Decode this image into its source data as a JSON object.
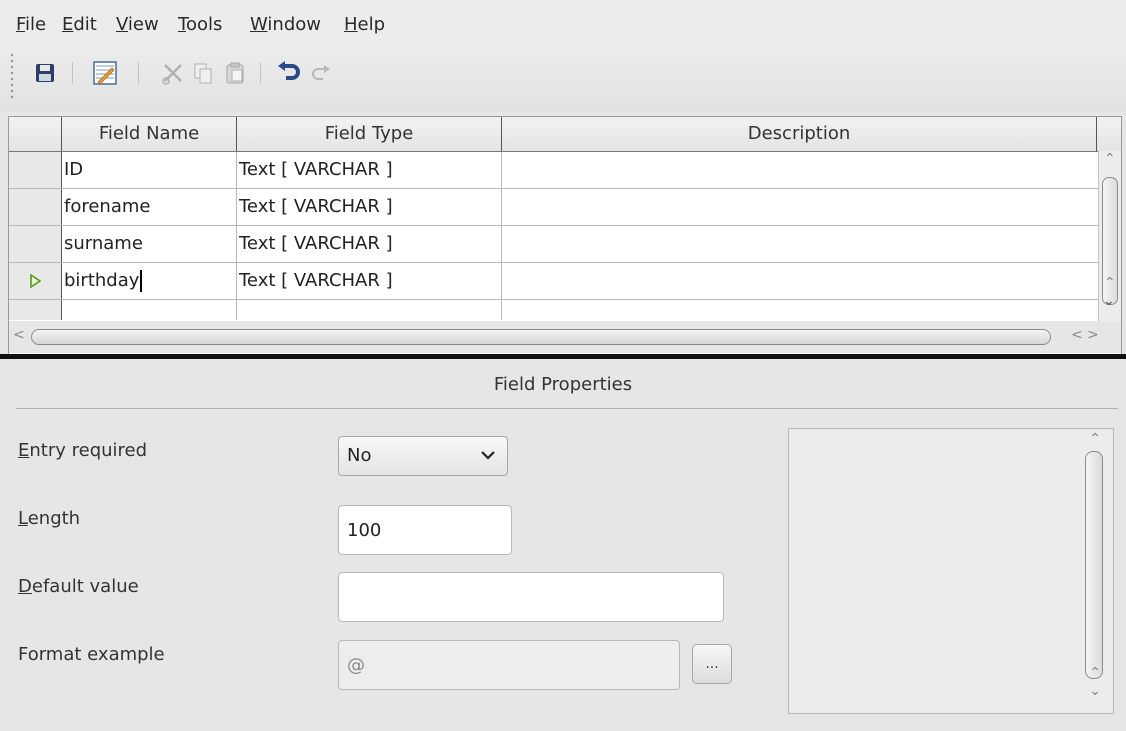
{
  "menu": [
    "File",
    "Edit",
    "View",
    "Tools",
    "Window",
    "Help"
  ],
  "table": {
    "headers": [
      "Field Name",
      "Field Type",
      "Description"
    ],
    "rows": [
      {
        "name": "ID",
        "type": "Text [ VARCHAR ]",
        "description": ""
      },
      {
        "name": "forename",
        "type": "Text [ VARCHAR ]",
        "description": ""
      },
      {
        "name": "surname",
        "type": "Text [ VARCHAR ]",
        "description": ""
      },
      {
        "name": "birthday",
        "type": "Text [ VARCHAR ]",
        "description": ""
      }
    ]
  },
  "properties": {
    "title": "Field Properties",
    "entry_required_label": "Entry required",
    "entry_required_value": "No",
    "length_label": "Length",
    "length_value": "100",
    "default_value_label": "Default value",
    "default_value": "",
    "format_example_label": "Format example",
    "format_example_value": "@",
    "format_button_label": "..."
  }
}
